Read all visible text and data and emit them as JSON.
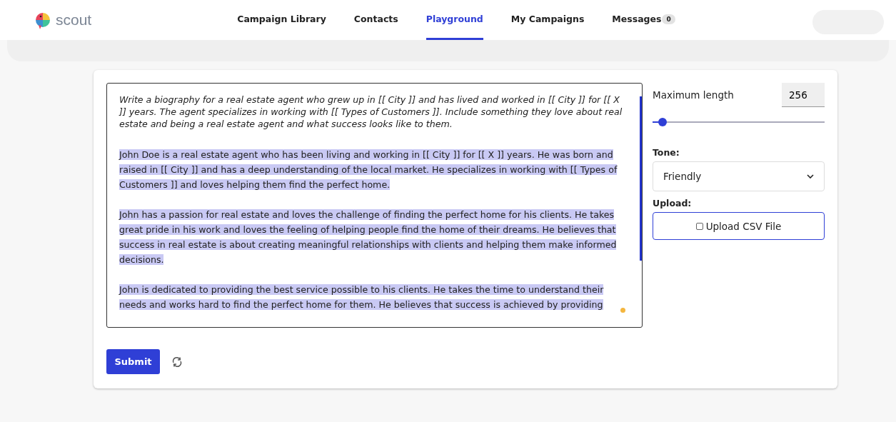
{
  "header": {
    "logo": "scout",
    "nav": [
      {
        "label": "Campaign Library",
        "selected": false
      },
      {
        "label": "Contacts",
        "selected": false
      },
      {
        "label": "Playground",
        "selected": true
      },
      {
        "label": "My Campaigns",
        "selected": false
      },
      {
        "label": "Messages",
        "selected": false,
        "badge": "0"
      }
    ]
  },
  "editor": {
    "prompt": "Write a biography for a real estate agent who grew up in [[ City ]] and has lived and worked in [[ City ]] for [[ X ]] years. The agent specializes in working with [[ Types of Customers ]]. Include something they love about real estate and being a real estate agent and what success looks like to them.",
    "paragraphs": [
      {
        "text": "John Doe is a real estate agent who has been living and working in [[ City ]] for [[ X ]] years. He was born and raised in [[ City ]] and has a deep understanding of the local market. He specializes in working with [[ Types of Customers ]] and loves helping them find the perfect home.",
        "selected": true
      },
      {
        "text": "John has a passion for real estate and loves the challenge of finding the perfect home for his clients. He takes great pride in his work and loves the feeling of helping people find the home of their dreams. He believes that success in real estate is about creating meaningful relationships with clients and helping them make informed decisions.",
        "selected": true
      },
      {
        "text": "John is dedicated to providing the best service possible to his clients. He takes the time to understand their needs and works hard to find the perfect home for them. He believes that success is achieved by providing",
        "selected": true
      }
    ]
  },
  "settings": {
    "max_length": {
      "label": "Maximum length",
      "value": "256",
      "level": 0.06
    },
    "tone": {
      "label": "Tone:",
      "value": "Friendly"
    },
    "upload": {
      "label": "Upload:",
      "button": "Upload CSV File",
      "checked": false
    }
  },
  "actions": {
    "submit": "Submit"
  }
}
